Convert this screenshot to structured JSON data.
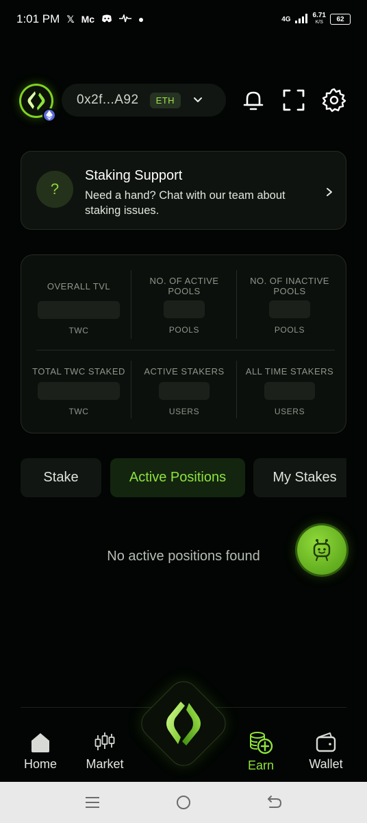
{
  "status_bar": {
    "time": "1:01 PM",
    "notif_icons": [
      "x-icon",
      "mc-icon",
      "discord-icon",
      "activity-icon",
      "dot-icon"
    ],
    "network": "4G",
    "speed_value": "6.71",
    "speed_unit": "K/S",
    "battery": "62"
  },
  "header": {
    "wallet_address": "0x2f...A92",
    "chain": "ETH"
  },
  "support": {
    "title": "Staking Support",
    "description": "Need a hand? Chat with our team about staking issues.",
    "icon_glyph": "?"
  },
  "stats": [
    {
      "label": "OVERALL TVL",
      "unit": "TWC"
    },
    {
      "label": "NO. OF ACTIVE POOLS",
      "unit": "POOLS"
    },
    {
      "label": "NO. OF INACTIVE POOLS",
      "unit": "POOLS"
    },
    {
      "label": "TOTAL TWC STAKED",
      "unit": "TWC"
    },
    {
      "label": "ACTIVE STAKERS",
      "unit": "USERS"
    },
    {
      "label": "ALL TIME STAKERS",
      "unit": "USERS"
    }
  ],
  "tabs": [
    {
      "label": "Stake",
      "active": false
    },
    {
      "label": "Active Positions",
      "active": true
    },
    {
      "label": "My Stakes",
      "active": false
    }
  ],
  "empty_message": "No active positions found",
  "nav": [
    {
      "label": "Home",
      "icon": "home-icon",
      "active": false
    },
    {
      "label": "Market",
      "icon": "candlestick-icon",
      "active": false
    },
    {
      "label": "Earn",
      "icon": "coins-icon",
      "active": true
    },
    {
      "label": "Wallet",
      "icon": "wallet-icon",
      "active": false
    }
  ],
  "colors": {
    "accent": "#8fe33c",
    "background": "#020503",
    "card": "#0f130f",
    "badge_bg": "#263222"
  }
}
